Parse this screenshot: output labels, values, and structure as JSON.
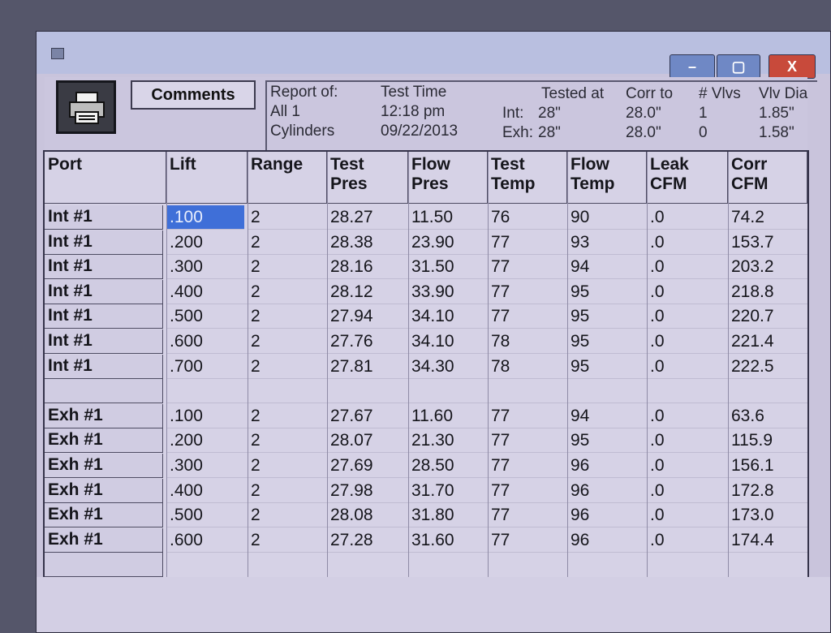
{
  "toolbar": {
    "comments_label": "Comments",
    "print_icon": "printer-icon"
  },
  "window_controls": {
    "minimize": "–",
    "maximize": "▢",
    "close": "X"
  },
  "report": {
    "report_of_label": "Report of:",
    "report_of_value1": "All 1",
    "report_of_value2": "Cylinders",
    "test_time_label": "Test Time",
    "test_time": "12:18 pm",
    "test_date": "09/22/2013",
    "tested_at_label": "Tested at",
    "int_label": "Int:",
    "int_tested": "28\"",
    "exh_label": "Exh:",
    "exh_tested": "28\"",
    "corr_to_label": "Corr to",
    "corr_int": "28.0\"",
    "corr_exh": "28.0\"",
    "vlvs_label": "# Vlvs",
    "vlvs_int": "1",
    "vlvs_exh": "0",
    "vlv_dia_label": "Vlv Dia",
    "vlv_dia_int": "1.85\"",
    "vlv_dia_exh": "1.58\""
  },
  "table": {
    "columns": [
      "Port",
      "Lift",
      "Range",
      "Test\nPres",
      "Flow\nPres",
      "Test\nTemp",
      "Flow\nTemp",
      "Leak\nCFM",
      "Corr\nCFM"
    ],
    "rows": [
      {
        "port": "Int #1",
        "lift": ".100",
        "range": "2",
        "test_pres": "28.27",
        "flow_pres": "11.50",
        "test_temp": "76",
        "flow_temp": "90",
        "leak_cfm": ".0",
        "corr_cfm": "74.2"
      },
      {
        "port": "Int #1",
        "lift": ".200",
        "range": "2",
        "test_pres": "28.38",
        "flow_pres": "23.90",
        "test_temp": "77",
        "flow_temp": "93",
        "leak_cfm": ".0",
        "corr_cfm": "153.7"
      },
      {
        "port": "Int #1",
        "lift": ".300",
        "range": "2",
        "test_pres": "28.16",
        "flow_pres": "31.50",
        "test_temp": "77",
        "flow_temp": "94",
        "leak_cfm": ".0",
        "corr_cfm": "203.2"
      },
      {
        "port": "Int #1",
        "lift": ".400",
        "range": "2",
        "test_pres": "28.12",
        "flow_pres": "33.90",
        "test_temp": "77",
        "flow_temp": "95",
        "leak_cfm": ".0",
        "corr_cfm": "218.8"
      },
      {
        "port": "Int #1",
        "lift": ".500",
        "range": "2",
        "test_pres": "27.94",
        "flow_pres": "34.10",
        "test_temp": "77",
        "flow_temp": "95",
        "leak_cfm": ".0",
        "corr_cfm": "220.7"
      },
      {
        "port": "Int #1",
        "lift": ".600",
        "range": "2",
        "test_pres": "27.76",
        "flow_pres": "34.10",
        "test_temp": "78",
        "flow_temp": "95",
        "leak_cfm": ".0",
        "corr_cfm": "221.4"
      },
      {
        "port": "Int #1",
        "lift": ".700",
        "range": "2",
        "test_pres": "27.81",
        "flow_pres": "34.30",
        "test_temp": "78",
        "flow_temp": "95",
        "leak_cfm": ".0",
        "corr_cfm": "222.5"
      },
      {
        "port": "",
        "lift": "",
        "range": "",
        "test_pres": "",
        "flow_pres": "",
        "test_temp": "",
        "flow_temp": "",
        "leak_cfm": "",
        "corr_cfm": ""
      },
      {
        "port": "Exh #1",
        "lift": ".100",
        "range": "2",
        "test_pres": "27.67",
        "flow_pres": "11.60",
        "test_temp": "77",
        "flow_temp": "94",
        "leak_cfm": ".0",
        "corr_cfm": "63.6"
      },
      {
        "port": "Exh #1",
        "lift": ".200",
        "range": "2",
        "test_pres": "28.07",
        "flow_pres": "21.30",
        "test_temp": "77",
        "flow_temp": "95",
        "leak_cfm": ".0",
        "corr_cfm": "115.9"
      },
      {
        "port": "Exh #1",
        "lift": ".300",
        "range": "2",
        "test_pres": "27.69",
        "flow_pres": "28.50",
        "test_temp": "77",
        "flow_temp": "96",
        "leak_cfm": ".0",
        "corr_cfm": "156.1"
      },
      {
        "port": "Exh #1",
        "lift": ".400",
        "range": "2",
        "test_pres": "27.98",
        "flow_pres": "31.70",
        "test_temp": "77",
        "flow_temp": "96",
        "leak_cfm": ".0",
        "corr_cfm": "172.8"
      },
      {
        "port": "Exh #1",
        "lift": ".500",
        "range": "2",
        "test_pres": "28.08",
        "flow_pres": "31.80",
        "test_temp": "77",
        "flow_temp": "96",
        "leak_cfm": ".0",
        "corr_cfm": "173.0"
      },
      {
        "port": "Exh #1",
        "lift": ".600",
        "range": "2",
        "test_pres": "27.28",
        "flow_pres": "31.60",
        "test_temp": "77",
        "flow_temp": "96",
        "leak_cfm": ".0",
        "corr_cfm": "174.4"
      }
    ],
    "selected_cell": {
      "row": 0,
      "col": "lift"
    }
  },
  "colors": {
    "selection": "#3f6fd8",
    "window_bg": "#c9c4dc",
    "close_button": "#c84a3b",
    "title_buttons": "#6f88c5"
  }
}
